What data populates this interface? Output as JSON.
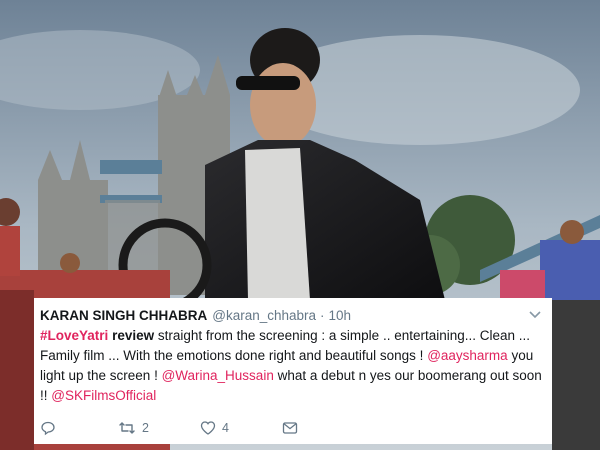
{
  "tweet": {
    "author_name": "KARAN SINGH CHHABRA",
    "handle": "@karan_chhabra",
    "separator": "·",
    "time": "10h",
    "text": {
      "hashtag": "#LoveYatri",
      "review_word": "review",
      "part1": " straight from the screening : a simple .. entertaining... Clean ... Family film ... With the emotions done right and beautiful songs ! ",
      "mention1": "@aaysharma",
      "part2": " you light up the screen ! ",
      "mention2": "@Warina_Hussain",
      "part3": " what a debut n yes our boomerang out soon !! ",
      "mention3": "@SKFilmsOfficial"
    },
    "actions": {
      "reply_icon": "reply-icon",
      "retweet_icon": "retweet-icon",
      "retweet_count": "2",
      "like_icon": "heart-icon",
      "like_count": "4",
      "dm_icon": "envelope-icon",
      "menu_icon": "chevron-down-icon"
    },
    "colors": {
      "link": "#e0245e",
      "secondary_text": "#657786",
      "primary_text": "#14171a",
      "card_bg": "#ffffff"
    }
  },
  "background": {
    "description_icon": "movie-still-tower-bridge-photo"
  }
}
